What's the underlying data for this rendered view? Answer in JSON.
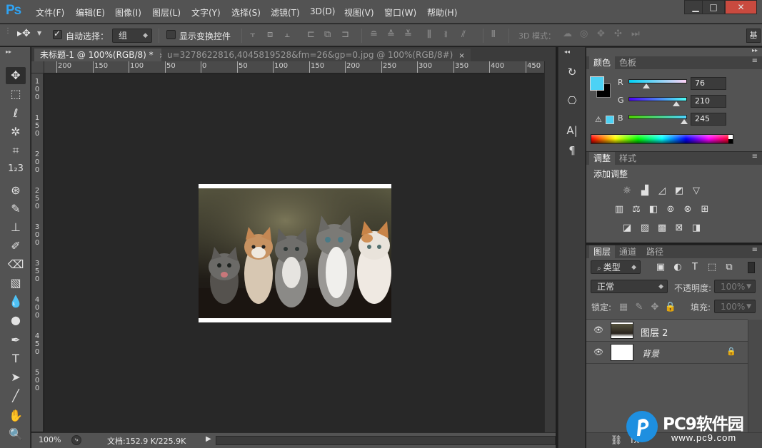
{
  "app": {
    "logo": "Ps"
  },
  "menu": [
    "文件(F)",
    "编辑(E)",
    "图像(I)",
    "图层(L)",
    "文字(Y)",
    "选择(S)",
    "滤镜(T)",
    "3D(D)",
    "视图(V)",
    "窗口(W)",
    "帮助(H)"
  ],
  "window_controls": {
    "minimize": "▁",
    "maximize": "□",
    "close": "✕"
  },
  "options": {
    "auto_select_label": "自动选择：",
    "auto_select_checked": true,
    "auto_select_value": "组",
    "show_transform_label": "显示变换控件",
    "show_transform_checked": false,
    "mode_3d_label": "3D 模式："
  },
  "tabs": [
    {
      "label": "未标题-1 @ 100%(RGB/8) *",
      "close": "×"
    },
    {
      "label": "u=3278622816,4045819528&fm=26&gp=0.jpg @ 100%(RGB/8#)",
      "close": "×"
    }
  ],
  "ruler": {
    "h_labels": [
      "200",
      "150",
      "100",
      "50",
      "0",
      "50",
      "100",
      "150",
      "200",
      "250",
      "300",
      "350",
      "400",
      "450"
    ],
    "v_labels": [
      "1\n0\n0",
      "1\n5\n0",
      "2\n0\n0",
      "2\n5\n0",
      "3\n0\n0",
      "3\n5\n0",
      "4\n0\n0",
      "4\n5\n0",
      "5\n0\n0"
    ]
  },
  "status": {
    "zoom": "100%",
    "doc_info": "文档:152.9 K/225.9K"
  },
  "color_panel": {
    "tabs": [
      "颜色",
      "色板"
    ],
    "foreground": "#4cd2f5",
    "background": "#000000",
    "channels": [
      {
        "label": "R",
        "value": "76"
      },
      {
        "label": "G",
        "value": "210"
      },
      {
        "label": "B",
        "value": "245"
      }
    ]
  },
  "adjust_panel": {
    "tabs": [
      "调整",
      "样式"
    ],
    "title": "添加调整"
  },
  "layers_panel": {
    "tabs": [
      "图层",
      "通道",
      "路径"
    ],
    "filter_kind": "类型",
    "blend_mode": "正常",
    "opacity_label": "不透明度:",
    "opacity_value": "100%",
    "lock_label": "锁定:",
    "fill_label": "填充:",
    "fill_value": "100%",
    "layers": [
      {
        "name": "图层 2",
        "visible": true,
        "locked": false
      },
      {
        "name": "背景",
        "visible": true,
        "locked": true
      }
    ]
  },
  "watermark": {
    "brand": "PC9软件园",
    "url": "www.pc9.com"
  }
}
